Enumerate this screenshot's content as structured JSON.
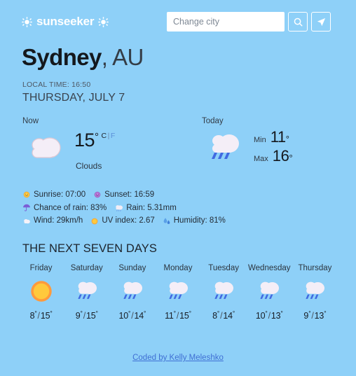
{
  "header": {
    "logo_text": "sunseeker",
    "logo_left_icon": "sun-gear-icon",
    "logo_right_icon": "sun-gear-icon",
    "search_placeholder": "Change city",
    "search_value": "",
    "search_button_icon": "search-icon",
    "locate_button_icon": "navigate-location-icon"
  },
  "location": {
    "city": "Sydney",
    "country": ", AU",
    "local_time": "LOCAL TIME: 16:50",
    "date": "THURSDAY, JULY 7"
  },
  "current": {
    "label": "Now",
    "icon": "cloud-icon",
    "temp": "15",
    "degree": "°",
    "unit_c": "C",
    "unit_separator": "|",
    "unit_f": "F",
    "description": "Clouds"
  },
  "today": {
    "label": "Today",
    "icon": "rain-cloud-icon",
    "min_label": "Min",
    "min_value": "11",
    "max_label": "Max",
    "max_value": "16",
    "degree": "°"
  },
  "details": {
    "rows": [
      [
        {
          "icon": "sunrise-sun-emoji",
          "text": "Sunrise: 07:00"
        },
        {
          "icon": "sunset-emoji",
          "text": "Sunset: 16:59"
        }
      ],
      [
        {
          "icon": "umbrella-emoji",
          "text": "Chance of rain: 83%"
        },
        {
          "icon": "rain-cloud-emoji",
          "text": "Rain: 5.31mm"
        }
      ],
      [
        {
          "icon": "wind-emoji",
          "text": "Wind: 29km/h"
        },
        {
          "icon": "uv-sun-emoji",
          "text": "UV index: 2.67"
        },
        {
          "icon": "humidity-droplets-emoji",
          "text": "Humidity: 81%"
        }
      ]
    ]
  },
  "forecast": {
    "title": "THE NEXT SEVEN DAYS",
    "days": [
      {
        "name": "Friday",
        "icon": "sun-icon",
        "min": "8",
        "max": "15",
        "degree": "°"
      },
      {
        "name": "Saturday",
        "icon": "rain-cloud-icon",
        "min": "9",
        "max": "15",
        "degree": "°"
      },
      {
        "name": "Sunday",
        "icon": "rain-cloud-icon",
        "min": "10",
        "max": "14",
        "degree": "°"
      },
      {
        "name": "Monday",
        "icon": "rain-cloud-icon",
        "min": "11",
        "max": "15",
        "degree": "°"
      },
      {
        "name": "Tuesday",
        "icon": "rain-cloud-icon",
        "min": "8",
        "max": "14",
        "degree": "°"
      },
      {
        "name": "Wednesday",
        "icon": "rain-cloud-icon",
        "min": "10",
        "max": "13",
        "degree": "°"
      },
      {
        "name": "Thursday",
        "icon": "rain-cloud-icon",
        "min": "9",
        "max": "13",
        "degree": "°"
      }
    ]
  },
  "footer": {
    "credit": "Coded by Kelly Meleshko"
  },
  "colors": {
    "background": "#8ed0f8",
    "cloud": "#f4eef7",
    "rain_drop": "#4169e1",
    "sun": "#ffc93c",
    "sun_ray": "#ff9a3c",
    "link": "#3f6fd4"
  }
}
